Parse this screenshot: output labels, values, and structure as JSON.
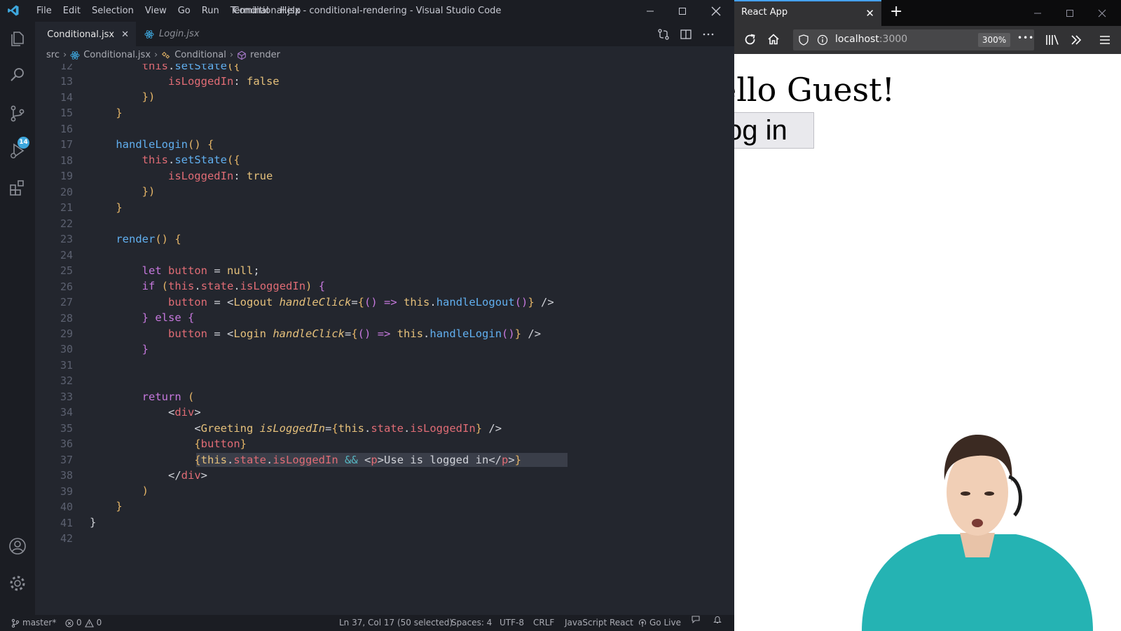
{
  "vscode": {
    "menu": [
      "File",
      "Edit",
      "Selection",
      "View",
      "Go",
      "Run",
      "Terminal",
      "Help"
    ],
    "window_title": "Conditional.jsx - conditional-rendering - Visual Studio Code",
    "source_control_badge": "14",
    "tabs": [
      {
        "label": "Conditional.jsx",
        "active": true,
        "close": "✕"
      },
      {
        "label": "Login.jsx",
        "active": false
      }
    ],
    "breadcrumb": {
      "folder": "src",
      "file": "Conditional.jsx",
      "class": "Conditional",
      "method": "render"
    },
    "line_numbers": [
      "12",
      "13",
      "14",
      "15",
      "16",
      "17",
      "18",
      "19",
      "20",
      "21",
      "22",
      "23",
      "24",
      "25",
      "26",
      "27",
      "28",
      "29",
      "30",
      "31",
      "32",
      "33",
      "34",
      "35",
      "36",
      "37",
      "38",
      "39",
      "40",
      "41",
      "42"
    ],
    "statusbar": {
      "branch": "master*",
      "errors": "0",
      "warnings": "0",
      "position": "Ln 37, Col 17 (50 selected)",
      "spaces": "Spaces: 4",
      "encoding": "UTF-8",
      "eol": "CRLF",
      "language": "JavaScript React",
      "golive": "Go Live"
    },
    "colors": {
      "accent": "#3ea7dd",
      "background": "#23262e"
    }
  },
  "browser": {
    "tab_title": "React App",
    "tab_close": "✕",
    "new_tab": "+",
    "url_host": "localhost",
    "url_port": ":3000",
    "zoom": "300%",
    "more": "•••",
    "page": {
      "greeting": "ello Guest!",
      "button": "og in"
    }
  }
}
